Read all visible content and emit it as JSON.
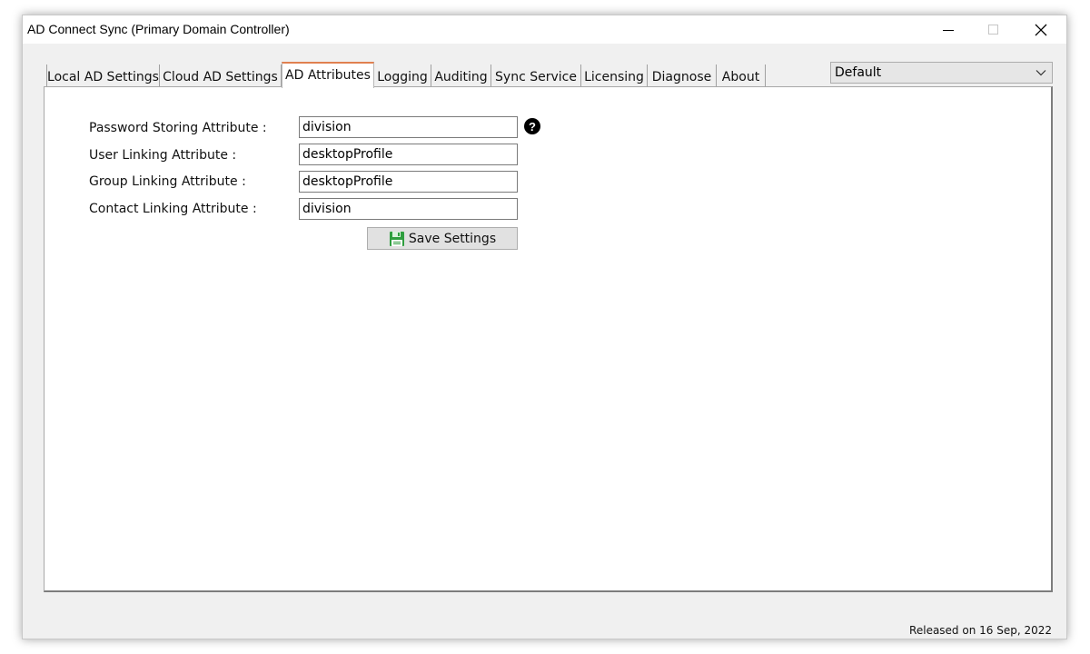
{
  "window": {
    "title": "AD Connect Sync (Primary Domain Controller)"
  },
  "tabs": [
    {
      "label": "Local AD Settings",
      "active": false
    },
    {
      "label": "Cloud AD Settings",
      "active": false
    },
    {
      "label": "AD Attributes",
      "active": true
    },
    {
      "label": "Logging",
      "active": false
    },
    {
      "label": "Auditing",
      "active": false
    },
    {
      "label": "Sync Service",
      "active": false
    },
    {
      "label": "Licensing",
      "active": false
    },
    {
      "label": "Diagnose",
      "active": false
    },
    {
      "label": "About",
      "active": false
    }
  ],
  "profile_select": {
    "selected": "Default"
  },
  "form": {
    "password_storing": {
      "label": "Password Storing Attribute :",
      "value": "division"
    },
    "user_linking": {
      "label": "User Linking Attribute :",
      "value": "desktopProfile"
    },
    "group_linking": {
      "label": "Group Linking Attribute :",
      "value": "desktopProfile"
    },
    "contact_linking": {
      "label": "Contact Linking Attribute :",
      "value": "division"
    },
    "help_glyph": "?",
    "save_label": "Save Settings"
  },
  "status": {
    "release": "Released on 16 Sep, 2022"
  },
  "icons": {
    "minimize": "minimize-icon",
    "maximize": "maximize-icon",
    "close": "close-icon",
    "help": "help-icon",
    "save": "floppy-disk-icon",
    "dropdown": "chevron-down-icon"
  },
  "colors": {
    "active_tab_accent": "#e08050",
    "save_icon_green": "#2e9e3e"
  }
}
